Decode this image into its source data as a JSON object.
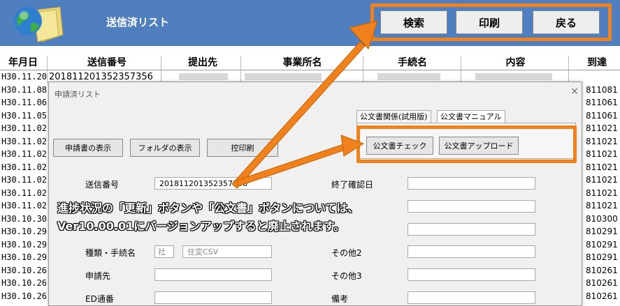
{
  "header": {
    "title": "送信済リスト",
    "buttons": [
      "検索",
      "印刷",
      "戻る"
    ]
  },
  "table": {
    "columns": [
      "年月日",
      "送信番号",
      "提出先",
      "事業所名",
      "手続名",
      "内容",
      "到達"
    ],
    "rows": [
      {
        "date": "H30.11.20",
        "number": "201811201352357356",
        "right": ""
      },
      {
        "date": "H30.11.08",
        "number": "",
        "right": "811081"
      },
      {
        "date": "H30.11.06",
        "number": "",
        "right": "811061"
      },
      {
        "date": "H30.11.05",
        "number": "",
        "right": "811061"
      },
      {
        "date": "H30.11.02",
        "number": "",
        "right": "811021"
      },
      {
        "date": "H30.11.02",
        "number": "",
        "right": "811021"
      },
      {
        "date": "H30.11.02",
        "number": "",
        "right": "811021"
      },
      {
        "date": "H30.11.02",
        "number": "",
        "right": "811021"
      },
      {
        "date": "H30.11.02",
        "number": "",
        "right": "811021"
      },
      {
        "date": "H30.11.02",
        "number": "",
        "right": "811021"
      },
      {
        "date": "H30.11.02",
        "number": "",
        "right": "811021"
      },
      {
        "date": "H30.10.30",
        "number": "",
        "right": "810300"
      },
      {
        "date": "H30.10.29",
        "number": "",
        "right": "810291"
      },
      {
        "date": "H30.10.29",
        "number": "",
        "right": "810291"
      },
      {
        "date": "H30.10.29",
        "number": "",
        "right": "810291"
      },
      {
        "date": "H30.10.26",
        "number": "",
        "right": "810261"
      },
      {
        "date": "H30.10.26",
        "number": "",
        "right": "810261"
      },
      {
        "date": "H30.10.26",
        "number": "",
        "right": "810261"
      }
    ]
  },
  "dialog": {
    "title": "申請済リスト",
    "close": "×",
    "tabs": [
      "公文書関係(試用版)",
      "公文書マニュアル"
    ],
    "buttons": {
      "show_application": "申請書の表示",
      "show_folder": "フォルダの表示",
      "print_copy": "控印刷",
      "check_document": "公文書チェック",
      "upload_document": "公文書アップロード"
    },
    "fields": {
      "send_number_label": "送信番号",
      "send_number_value": "201811201352357356",
      "end_confirm_label": "終了確認日",
      "type_label": "種類・手続名",
      "type_code": "社",
      "type_value": "住変CSV",
      "other2_label": "その他2",
      "applicant_label": "申請先",
      "other3_label": "その他3",
      "ed_label": "ED通番",
      "note_label": "備考"
    }
  },
  "annotation": {
    "line1": "進捗状況の「更新」ボタンや「公文書」ボタンについては、",
    "line2": "Ver10.00.01にバージョンアップすると廃止されます。"
  },
  "colors": {
    "header_bg": "#4f7fbe",
    "accent": "#f0821e"
  }
}
